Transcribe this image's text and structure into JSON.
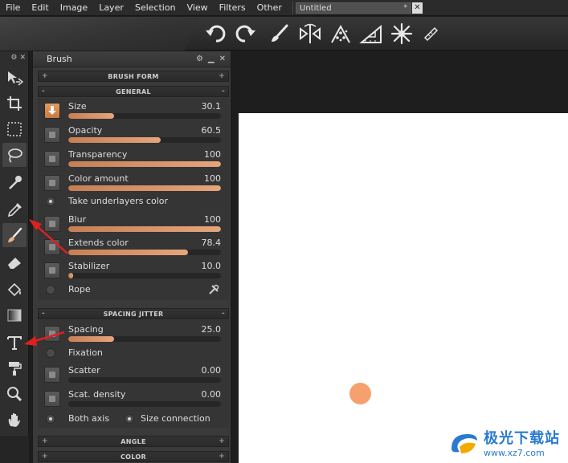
{
  "menu": {
    "items": [
      "File",
      "Edit",
      "Image",
      "Layer",
      "Selection",
      "View",
      "Filters",
      "Other"
    ],
    "document_tab": "Untitled",
    "modified_marker": "*",
    "close_symbol": "✕"
  },
  "toolbar": {
    "icons": [
      "undo-icon",
      "redo-icon",
      "brush-icon",
      "symmetry-icon",
      "particles-icon",
      "ruler-triangle-icon",
      "snowflake-pattern-icon",
      "ruler-icon"
    ]
  },
  "tools": {
    "icons": [
      "move-icon",
      "crop-icon",
      "rect-select-icon",
      "lasso-icon",
      "magic-wand-icon",
      "eyedropper-icon",
      "brush-icon",
      "eraser-icon",
      "fill-icon",
      "gradient-icon",
      "text-icon",
      "roller-icon",
      "zoom-icon",
      "hand-icon"
    ],
    "active_index": 6
  },
  "brush_panel": {
    "title": "Brush",
    "sections": {
      "brush_form": "BRUSH FORM",
      "general": "GENERAL",
      "spacing_jitter": "SPACING JITTER",
      "angle": "ANGLE",
      "color": "COLOR"
    },
    "general": [
      {
        "label": "Size",
        "value": "30.1",
        "fraction": 0.3
      },
      {
        "label": "Opacity",
        "value": "60.5",
        "fraction": 0.605
      },
      {
        "label": "Transparency",
        "value": "100",
        "fraction": 1.0
      },
      {
        "label": "Color amount",
        "value": "100",
        "fraction": 1.0
      }
    ],
    "take_underlayers": "Take underlayers color",
    "general2": [
      {
        "label": "Blur",
        "value": "100",
        "fraction": 1.0
      },
      {
        "label": "Extends color",
        "value": "78.4",
        "fraction": 0.784
      },
      {
        "label": "Stabilizer",
        "value": "10.0",
        "fraction": 0.03
      }
    ],
    "rope": "Rope",
    "spacing": [
      {
        "label": "Spacing",
        "value": "25.0",
        "fraction": 0.3
      }
    ],
    "fixation": "Fixation",
    "spacing2": [
      {
        "label": "Scatter",
        "value": "0.00",
        "fraction": 0.0
      },
      {
        "label": "Scat. density",
        "value": "0.00",
        "fraction": 0.0
      }
    ],
    "both_axis": "Both axis",
    "size_connection": "Size connection"
  },
  "watermark": {
    "cn": "极光下载站",
    "url": "www.xz7.com"
  },
  "colors": {
    "accent": "#e6a57c",
    "dot": "#f5a06e",
    "arrow": "#e02020"
  }
}
